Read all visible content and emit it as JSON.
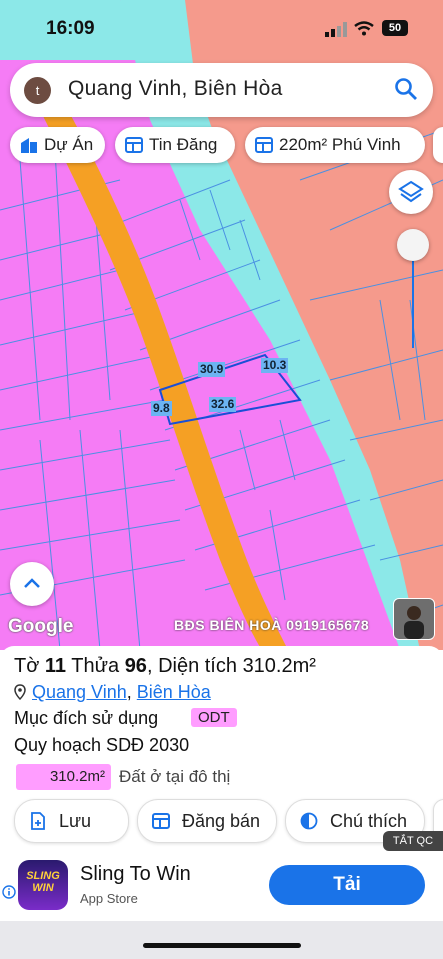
{
  "status_bar": {
    "time": "16:09",
    "battery": "50"
  },
  "search": {
    "avatar_letter": "t",
    "query": "Quang Vinh, Biên Hòa"
  },
  "chips": [
    {
      "label": "Dự Án",
      "icon": "building-icon"
    },
    {
      "label": "Tin Đăng",
      "icon": "listing-icon"
    },
    {
      "label": "220m² Phú Vinh",
      "icon": "listing-icon"
    }
  ],
  "map": {
    "dimensions": {
      "top": "30.9",
      "right": "10.3",
      "left": "9.8",
      "bottom": "32.6"
    },
    "watermark": "BĐS BIÊN HOÀ 0919165678",
    "google_logo": "Google",
    "colors": {
      "residential": "#f57cf5",
      "water": "#8ce8e8",
      "agricultural": "#f59a8c",
      "road": "#f5a024",
      "parcel_line": "#4a90e2"
    }
  },
  "parcel": {
    "to_label": "Tờ",
    "to_value": "11",
    "thua_label": "Thửa",
    "thua_value": "96",
    "area_label": "Diện tích",
    "area_value": "310.2m²",
    "ward": "Quang Vinh",
    "city": "Biên Hòa",
    "purpose_label": "Mục đích sử dụng",
    "purpose_code": "ODT",
    "plan_label": "Quy hoạch SDĐ 2030",
    "plan_area": "310.2m²",
    "plan_desc": "Đất ở tại đô thị"
  },
  "actions": [
    {
      "label": "Lưu",
      "icon": "save-icon"
    },
    {
      "label": "Đăng bán",
      "icon": "post-icon"
    },
    {
      "label": "Chú thích",
      "icon": "legend-icon"
    }
  ],
  "ad": {
    "close_label": "TẮT QC",
    "app_name": "Sling To Win",
    "store": "App Store",
    "cta": "Tải",
    "icon_text": "SLING WIN"
  }
}
